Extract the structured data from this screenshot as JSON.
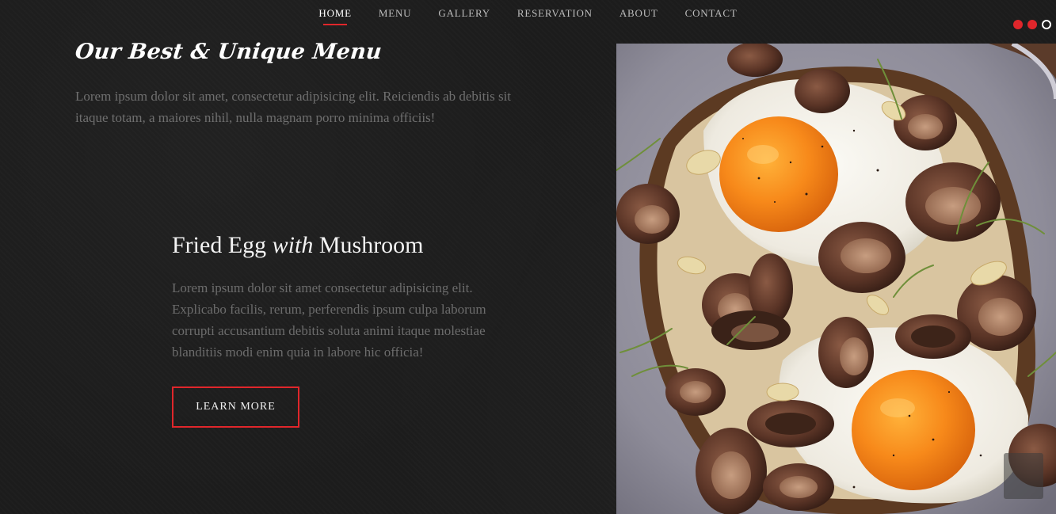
{
  "nav": {
    "items": [
      {
        "label": "HOME",
        "active": true
      },
      {
        "label": "MENU",
        "active": false
      },
      {
        "label": "GALLERY",
        "active": false
      },
      {
        "label": "RESERVATION",
        "active": false
      },
      {
        "label": "ABOUT",
        "active": false
      },
      {
        "label": "CONTACT",
        "active": false
      }
    ]
  },
  "slider": {
    "dots": [
      {
        "state": "filled"
      },
      {
        "state": "filled"
      },
      {
        "state": "active-ring"
      }
    ]
  },
  "section": {
    "title": "Our Best & Unique Menu",
    "description": "Lorem ipsum dolor sit amet, consectetur adipisicing elit. Reiciendis ab debitis sit itaque totam, a maiores nihil, nulla magnam porro minima officiis!"
  },
  "dish": {
    "title_part1": "Fried Egg",
    "title_em": "with",
    "title_part2": "Mushroom",
    "description": "Lorem ipsum dolor sit amet consectetur adipisicing elit. Explicabo facilis, rerum, perferendis ipsum culpa laborum corrupti accusantium debitis soluta animi itaque molestiae blanditiis modi enim quia in labore hic officia!",
    "button_label": "LEARN MORE",
    "image_icon": "fried-egg-mushroom-photo"
  },
  "colors": {
    "accent": "#e0262b",
    "background": "#1c1c1c",
    "muted_text": "#6f6f6f"
  }
}
